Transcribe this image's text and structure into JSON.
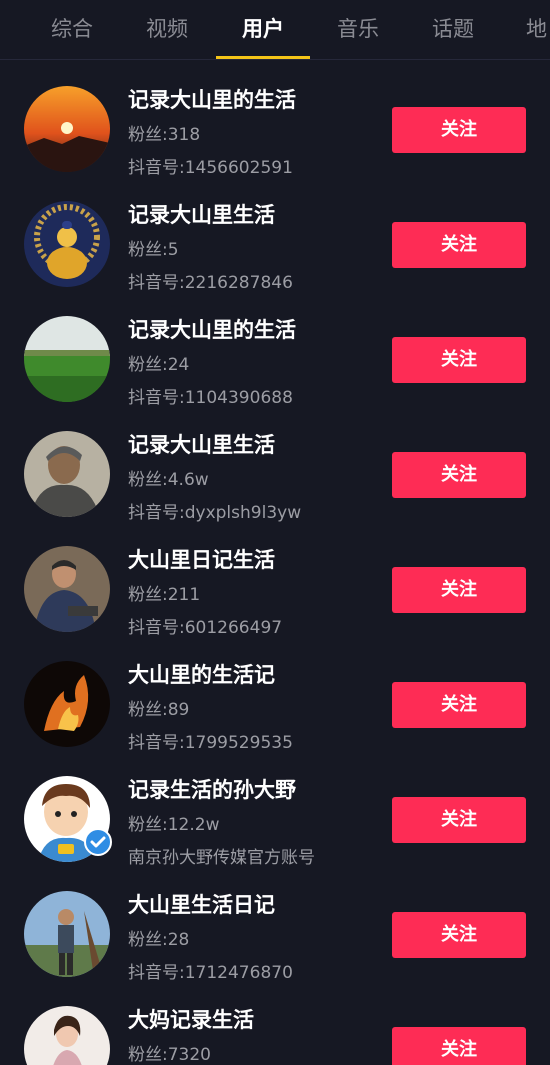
{
  "tabs": [
    {
      "label": "综合"
    },
    {
      "label": "视频"
    },
    {
      "label": "用户",
      "active": true
    },
    {
      "label": "音乐"
    },
    {
      "label": "话题"
    },
    {
      "label": "地"
    }
  ],
  "users": [
    {
      "name": "记录大山里的生活",
      "fans": "粉丝:318",
      "sub": "抖音号:1456602591",
      "follow": "关注"
    },
    {
      "name": "记录大山里生活",
      "fans": "粉丝:5",
      "sub": "抖音号:2216287846",
      "follow": "关注"
    },
    {
      "name": "记录大山里的生活",
      "fans": "粉丝:24",
      "sub": "抖音号:1104390688",
      "follow": "关注"
    },
    {
      "name": "记录大山里生活",
      "fans": "粉丝:4.6w",
      "sub": "抖音号:dyxplsh9l3yw",
      "follow": "关注"
    },
    {
      "name": "大山里日记生活",
      "fans": "粉丝:211",
      "sub": "抖音号:601266497",
      "follow": "关注"
    },
    {
      "name": "大山里的生活记",
      "fans": "粉丝:89",
      "sub": "抖音号:1799529535",
      "follow": "关注"
    },
    {
      "name": "记录生活的孙大野",
      "fans": "粉丝:12.2w",
      "sub": "南京孙大野传媒官方账号",
      "follow": "关注",
      "verified": true
    },
    {
      "name": "大山里生活日记",
      "fans": "粉丝:28",
      "sub": "抖音号:1712476870",
      "follow": "关注"
    },
    {
      "name": "大妈记录生活",
      "fans": "粉丝:7320",
      "sub": "",
      "follow": "关注"
    }
  ],
  "colors": {
    "background": "#161823",
    "follow_button": "#fe2c55",
    "tab_indicator": "#f5c518",
    "verified_badge": "#2f8de4"
  }
}
